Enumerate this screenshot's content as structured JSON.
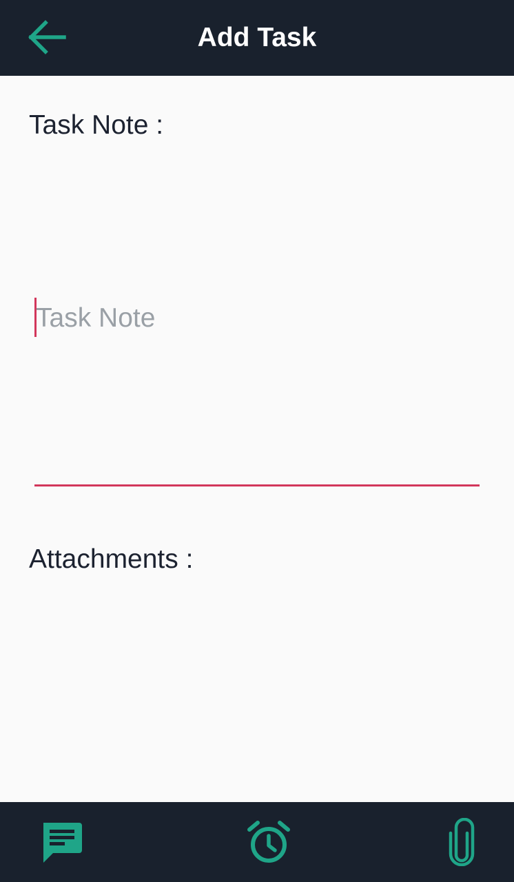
{
  "app_bar": {
    "title": "Add Task",
    "back_icon": "arrow-back-icon"
  },
  "task_note": {
    "label": "Task Note :",
    "placeholder": "Task Note",
    "value": ""
  },
  "attachments": {
    "label": "Attachments :"
  },
  "bottom_bar": {
    "items": [
      {
        "icon": "note-icon"
      },
      {
        "icon": "alarm-icon"
      },
      {
        "icon": "attachment-icon"
      }
    ]
  },
  "colors": {
    "bar_background": "#19212d",
    "accent_teal": "#1fa588",
    "accent_red": "#d2365b",
    "page_background": "#fafafa",
    "text_dark": "#1c2230",
    "placeholder_gray": "#9aa0a6"
  }
}
